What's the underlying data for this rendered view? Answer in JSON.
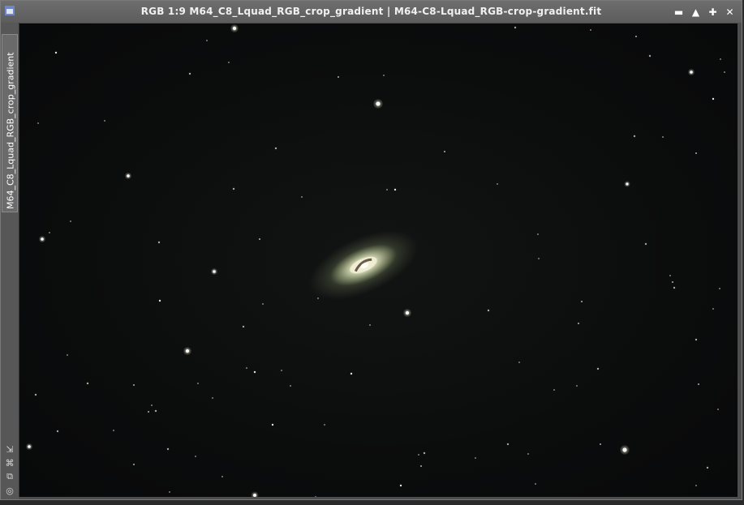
{
  "window": {
    "title": "RGB 1:9 M64_C8_Lquad_RGB_crop_gradient | M64-C8-Lquad_RGB-crop-gradient.fit",
    "view_tab_label": "M64_C8_Lquad_RGB_crop_gradient",
    "icons": {
      "app": "window-icon",
      "minimize": "minimize-icon",
      "shade": "shade-icon",
      "maximize": "maximize-icon",
      "close": "close-icon"
    },
    "button_glyphs": {
      "minimize": "▬",
      "shade": "▲",
      "maximize": "✚",
      "close": "✕"
    }
  },
  "sidebar": {
    "tools": [
      {
        "name": "zoom-to-fit-icon",
        "glyph": "⇲"
      },
      {
        "name": "preview-icon",
        "glyph": "⌘"
      },
      {
        "name": "clone-icon",
        "glyph": "⧉"
      },
      {
        "name": "target-icon",
        "glyph": "◎"
      }
    ]
  },
  "colors": {
    "sky": "#0b0c0c",
    "galaxy_core": "#fffbe8",
    "galaxy_halo": "#b9c99a",
    "star": "#ffffff",
    "frame": "#5a5a5a"
  }
}
